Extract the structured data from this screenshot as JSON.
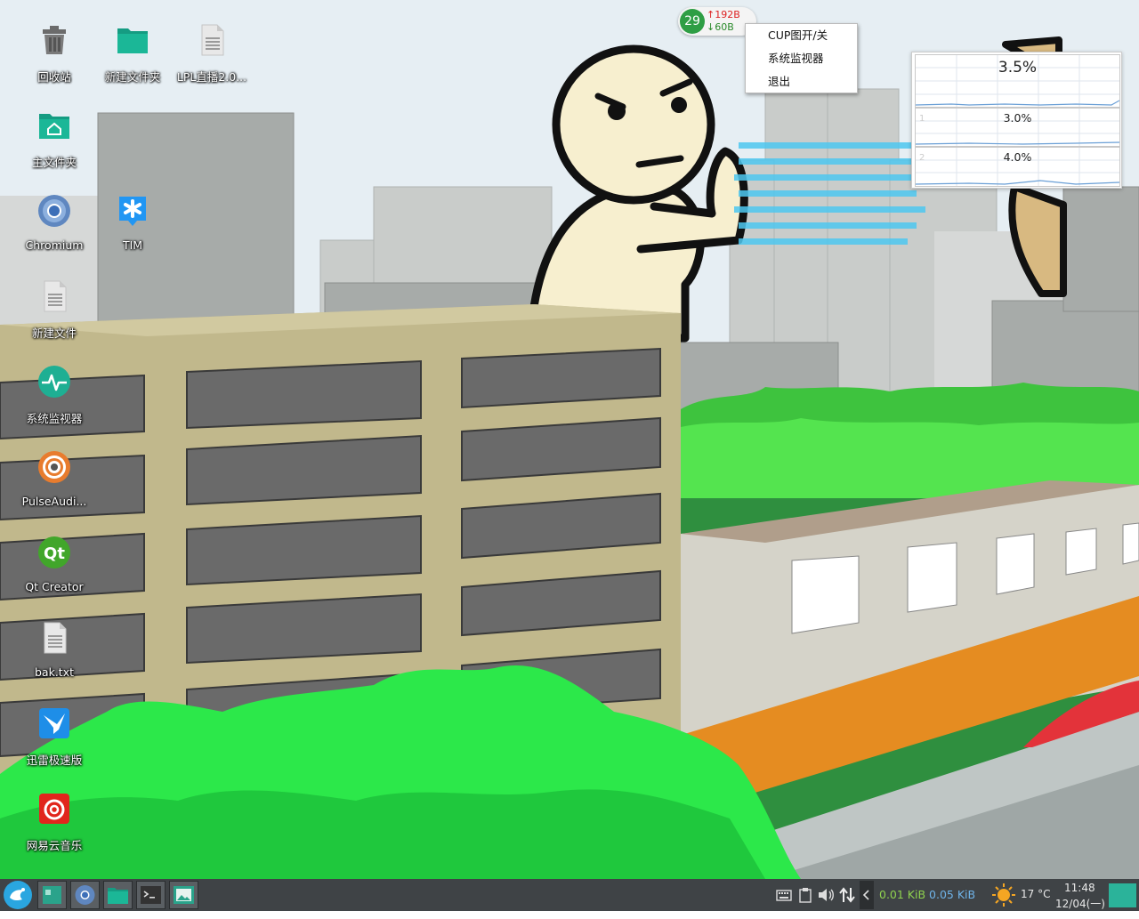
{
  "desktop": {
    "icons": [
      {
        "label": "回收站"
      },
      {
        "label": "新建文件夹"
      },
      {
        "label": "LPL直播2.0..."
      },
      {
        "label": "主文件夹"
      },
      {
        "label": "Chromium"
      },
      {
        "label": "TIM"
      },
      {
        "label": "新建文件"
      },
      {
        "label": "系统监视器"
      },
      {
        "label": "PulseAudi..."
      },
      {
        "label": "Qt Creator"
      },
      {
        "label": "bak.txt"
      },
      {
        "label": "迅雷极速版"
      },
      {
        "label": "网易云音乐"
      }
    ]
  },
  "net_ball": {
    "count": "29",
    "up": "↑192B",
    "down": "↓60B"
  },
  "context_menu": {
    "items": [
      {
        "label": "CUP图开/关"
      },
      {
        "label": "系统监视器"
      },
      {
        "label": "退出"
      }
    ]
  },
  "cpu_widget": {
    "total": "3.5%",
    "cpu1_index": "1",
    "cpu1": "3.0%",
    "cpu2_index": "2",
    "cpu2": "4.0%"
  },
  "taskbar": {
    "net_up": "0.01 KiB",
    "net_down": "0.05 KiB",
    "temperature": "17 °C",
    "time": "11:48",
    "date": "12/04(一)",
    "colors": {
      "up": "#8fd14f",
      "down": "#6fb3e8",
      "accent": "#2bb39a"
    }
  }
}
